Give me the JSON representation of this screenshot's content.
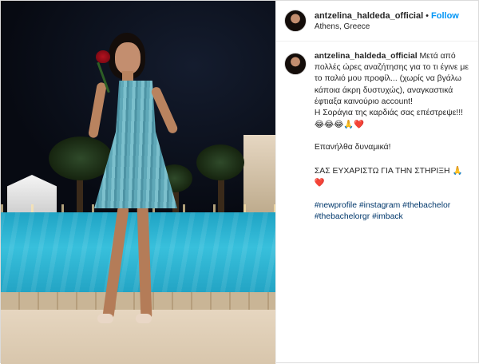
{
  "post": {
    "username": "antzelina_haldeda_official",
    "follow_label": "Follow",
    "dot": "•",
    "location": "Athens, Greece"
  },
  "caption": {
    "line1": "Μετά από πολλές ώρες αναζήτησης για το τι έγινε με το παλιό μου προφίλ... (χωρίς να βγάλω κάποια άκρη δυστυχώς), αναγκαστικά έφτιαξα καινούριο account!",
    "line2": "Η Σοράγια της καρδιάς σας επέστρεψε!!!",
    "line2_emojis": "😂😂😂🙏❤️",
    "line3": "Επανήλθα δυναμικά!",
    "line4": "ΣΑΣ ΕΥΧΑΡΙΣΤΩ ΓΙΑ ΤΗΝ ΣΤΗΡΙΞΗ",
    "line4_emojis": "🙏❤️",
    "hashtags": [
      "#newprofile",
      "#instagram",
      "#thebachelor",
      "#thebachelorgr",
      "#imback"
    ]
  }
}
